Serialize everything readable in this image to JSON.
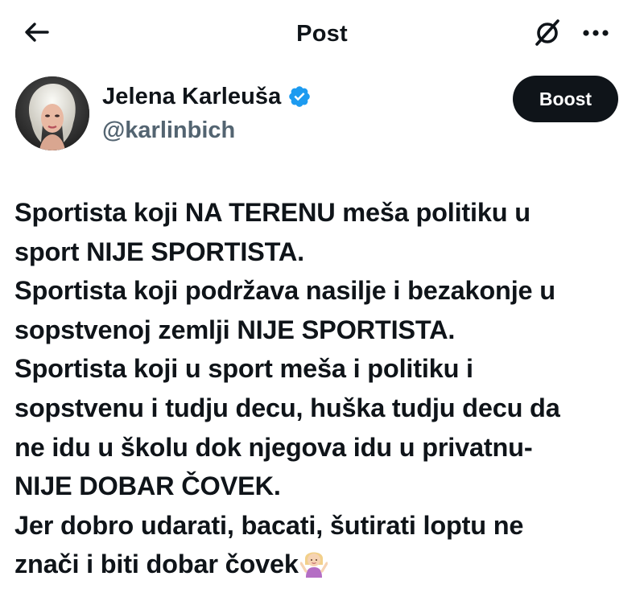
{
  "header": {
    "title": "Post",
    "back_icon": "arrow-left-icon",
    "grok_icon": "grok-icon",
    "more_icon": "more-horizontal-icon"
  },
  "author": {
    "display_name": "Jelena Karleuša",
    "handle": "@karlinbich",
    "verified_icon": "verified-badge-icon",
    "verified_color": "#1d9bf0",
    "boost_label": "Boost"
  },
  "post": {
    "lines": [
      "Sportista koji NA TERENU meša politiku u",
      "sport  NIJE SPORTISTA.",
      "Sportista koji podržava nasilje i bezakonje u",
      "sopstvenoj zemlji NIJE SPORTISTA.",
      "Sportista koji u sport meša i politiku i",
      "sopstvenu i tudju decu, huška tudju decu da",
      "ne idu u školu dok njegova idu u privatnu-",
      "NIJE DOBAR ČOVEK.",
      "Jer dobro udarati, bacati, šutirati loptu ne",
      "znači i biti dobar čovek"
    ],
    "trailing_emoji": "person-shrugging-emoji"
  },
  "colors": {
    "text_primary": "#0f1419",
    "text_secondary": "#536471",
    "button_bg": "#0f1419",
    "accent": "#1d9bf0"
  }
}
